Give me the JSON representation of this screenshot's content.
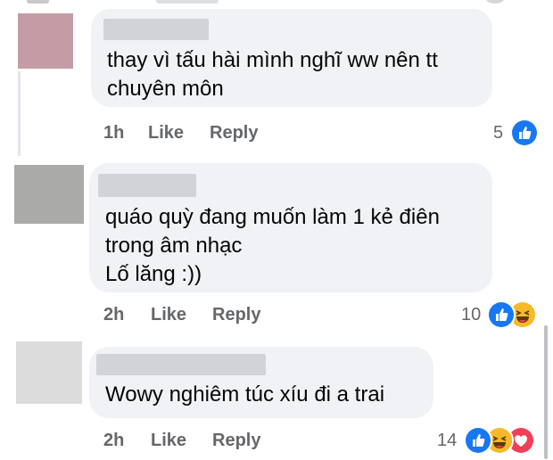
{
  "comments": [
    {
      "text": "thay vì tấu hài mình nghĩ ww nên tt\nchuyên môn",
      "time": "1h",
      "like_label": "Like",
      "reply_label": "Reply",
      "reaction_count": "5",
      "reactions": [
        "like-icon"
      ],
      "avatar_color": "#c59ca6"
    },
    {
      "text": "quáo quỳ đang muốn làm 1 kẻ điên\ntrong âm nhạc\nLố lăng :))",
      "time": "2h",
      "like_label": "Like",
      "reply_label": "Reply",
      "reaction_count": "10",
      "reactions": [
        "like-icon",
        "haha-icon"
      ],
      "avatar_color": "#aaaaa8"
    },
    {
      "text": "Wowy nghiêm túc xíu đi a trai",
      "time": "2h",
      "like_label": "Like",
      "reply_label": "Reply",
      "reaction_count": "14",
      "reactions": [
        "like-icon",
        "haha-icon",
        "love-icon"
      ],
      "avatar_color": "#dcdcdc"
    }
  ],
  "colors": {
    "like_blue": "#1877f2",
    "haha_yellow": "#f7b928",
    "love_red": "#f33e58",
    "bubble_bg": "#f0f2f5",
    "meta_gray": "#65676b"
  }
}
